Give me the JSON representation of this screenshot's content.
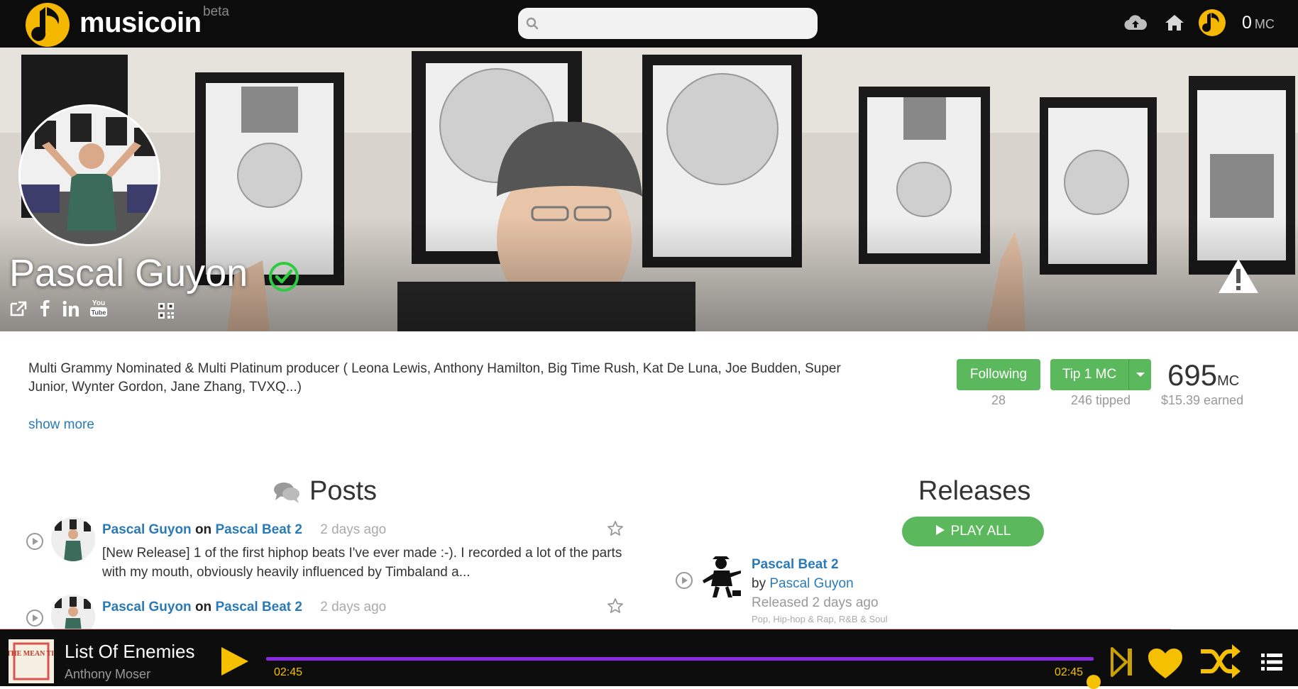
{
  "header": {
    "logo_text": "musicoin",
    "beta_label": "beta",
    "search_placeholder": "",
    "balance_value": "0",
    "balance_unit": "MC",
    "icons": [
      "upload-cloud-icon",
      "home-icon",
      "user-avatar-icon"
    ]
  },
  "profile": {
    "name": "Pascal Guyon",
    "verified": true,
    "social_icons": [
      "external-link-icon",
      "facebook-icon",
      "linkedin-icon",
      "youtube-icon",
      "qr-code-icon"
    ],
    "bio": "Multi Grammy Nominated & Multi Platinum producer ( Leona Lewis, Anthony Hamilton, Big Time Rush, Kat De Luna, Joe Budden, Super Junior, Wynter Gordon, Jane Zhang, TVXQ...)",
    "show_more": "show more",
    "following_label": "Following",
    "following_count": "28",
    "tip_label": "Tip 1 MC",
    "tipped_label": "246 tipped",
    "earned_value": "695",
    "earned_unit": "MC",
    "earned_usd": "$15.39 earned"
  },
  "posts": {
    "title": "Posts",
    "items": [
      {
        "author": "Pascal Guyon",
        "on": "on",
        "target": "Pascal Beat 2",
        "time": "2 days ago",
        "text": "[New Release] 1 of the first hiphop beats I've ever made :-). I recorded a lot of the parts with my mouth, obviously heavily influenced by Timbaland a..."
      },
      {
        "author": "Pascal Guyon",
        "on": "on",
        "target": "Pascal Beat 2",
        "time": "2 days ago",
        "text": ""
      }
    ]
  },
  "releases": {
    "title": "Releases",
    "play_all": "PLAY ALL",
    "items": [
      {
        "title": "Pascal Beat 2",
        "by": "by",
        "artist": "Pascal Guyon",
        "released": "Released 2 days ago",
        "genres": "Pop, Hip-hop & Rap, R&B & Soul"
      }
    ]
  },
  "player": {
    "track_title": "List Of Enemies",
    "track_artist": "Anthony Moser",
    "album_art_text": "IN THE MEAN TIME",
    "current_time": "02:45",
    "end_time": "02:45",
    "progress": 1.0,
    "colors": {
      "accent": "#f5c000",
      "track": "#8a2be2"
    }
  },
  "colors": {
    "green": "#5cb85c",
    "link": "#2a7ab8",
    "topbar": "#0c0c0c"
  }
}
